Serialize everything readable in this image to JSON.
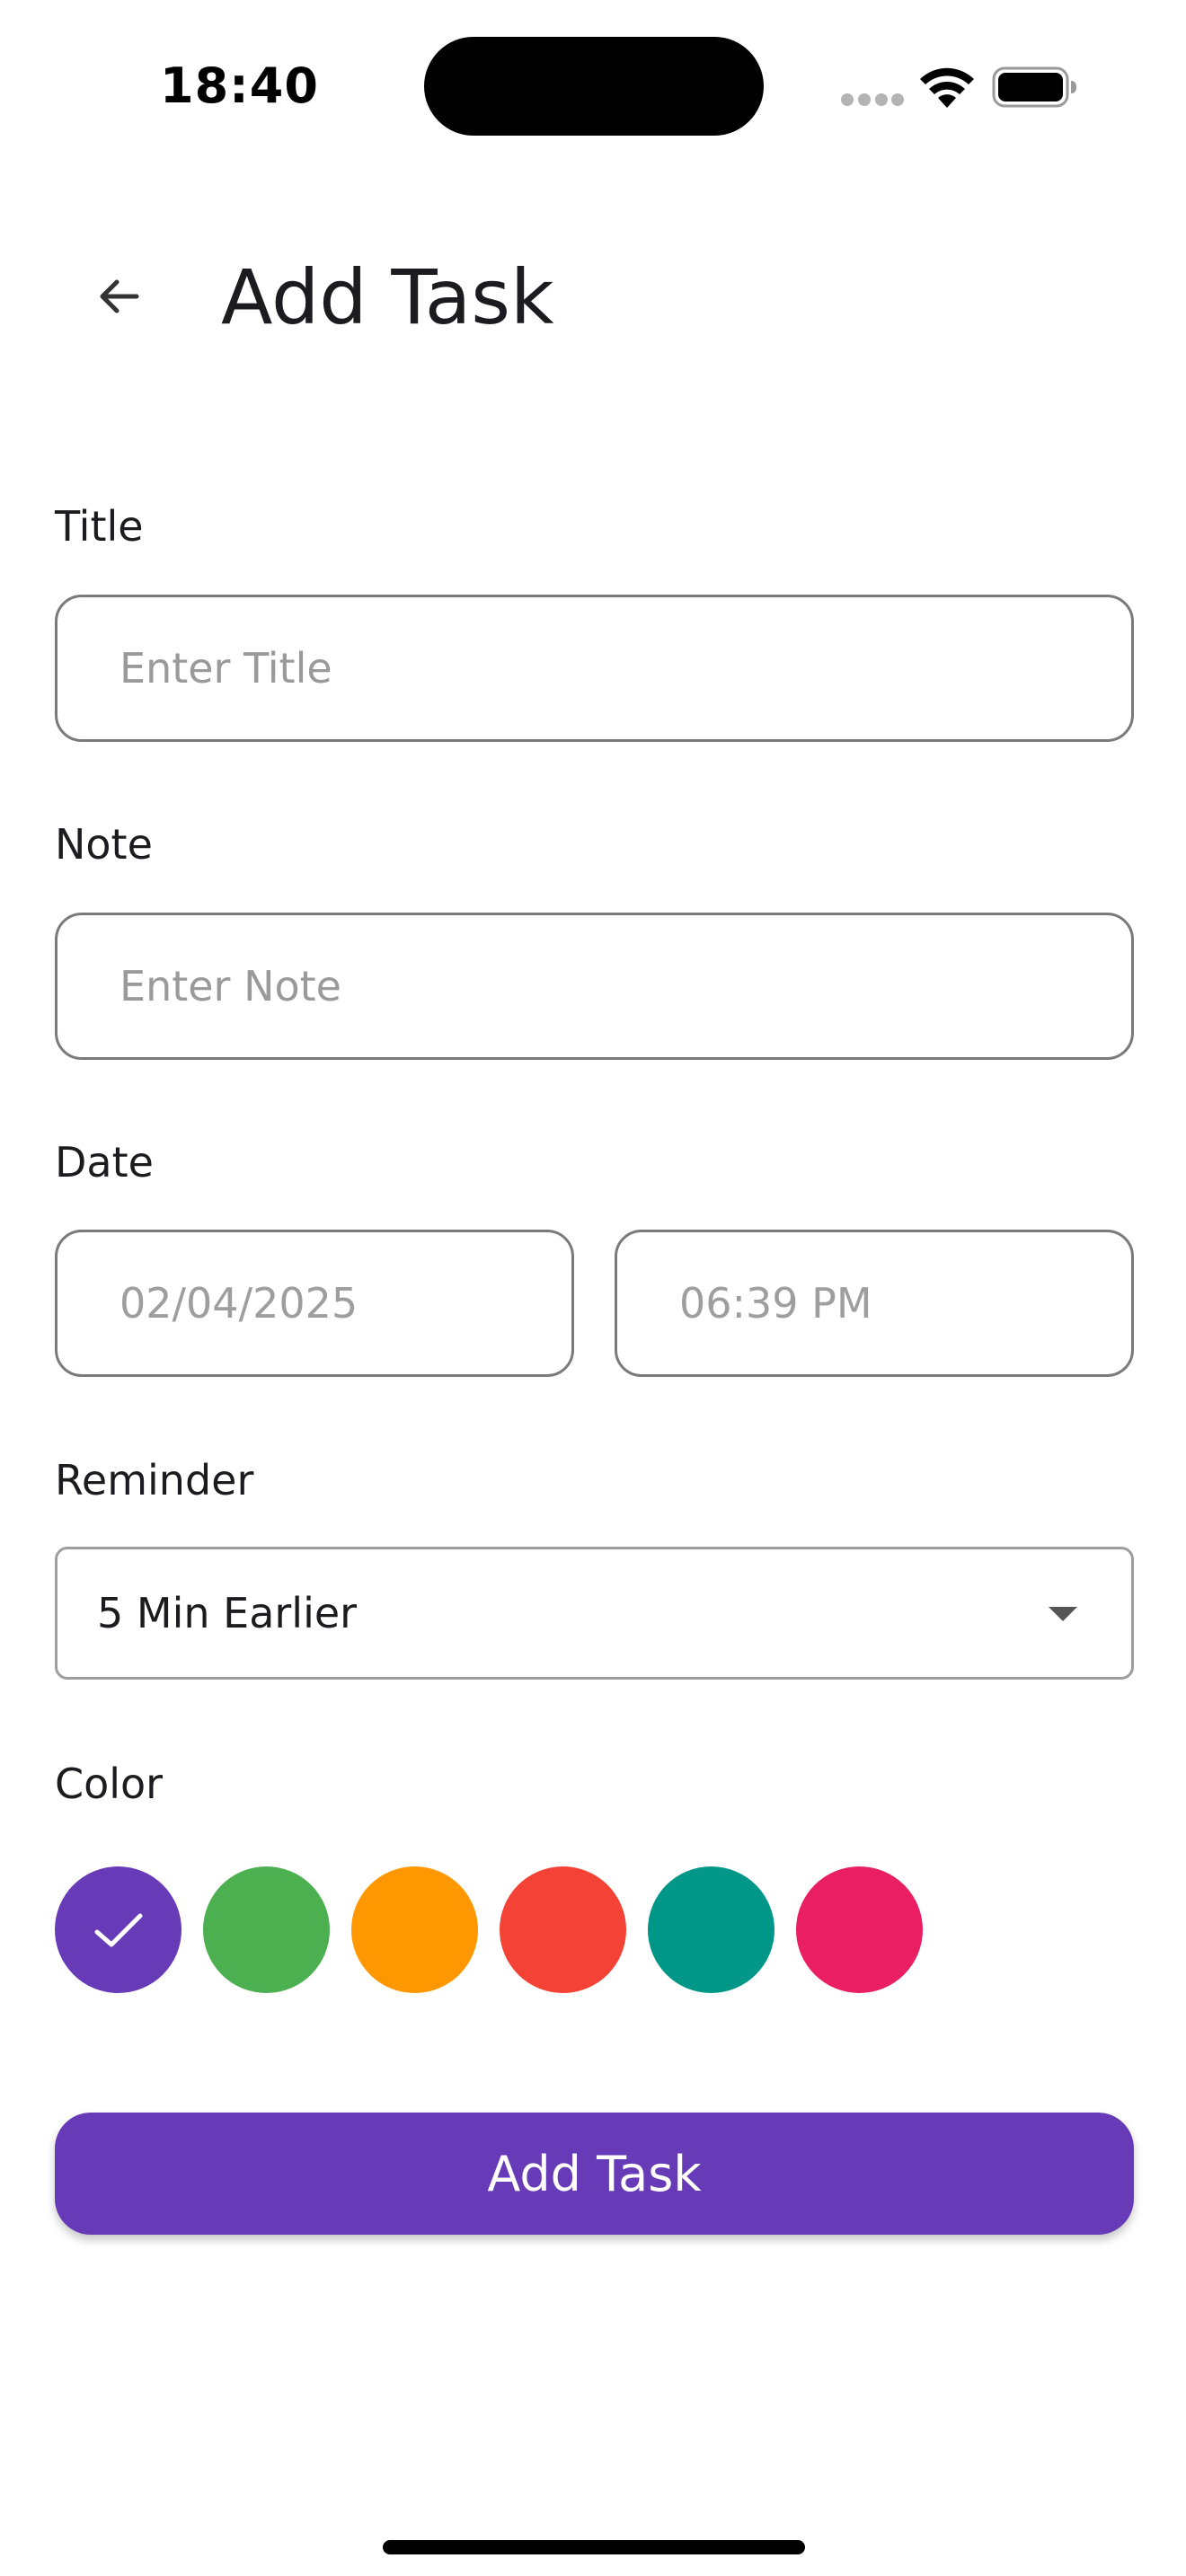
{
  "status_bar": {
    "time": "18:40",
    "wifi_icon": "wifi-icon",
    "battery_icon": "battery-icon",
    "cellular_icon": "cellular-dots-icon"
  },
  "app_bar": {
    "back_icon": "arrow-left-icon",
    "title": "Add Task"
  },
  "form": {
    "title": {
      "label": "Title",
      "value": "",
      "placeholder": "Enter Title"
    },
    "note": {
      "label": "Note",
      "value": "",
      "placeholder": "Enter Note"
    },
    "date": {
      "label": "Date",
      "date_value": "02/04/2025",
      "time_value": "06:39 PM"
    },
    "reminder": {
      "label": "Reminder",
      "selected": "5 Min Earlier",
      "dropdown_icon": "caret-down-icon"
    },
    "color": {
      "label": "Color",
      "selected_index": 0,
      "check_icon": "check-icon",
      "swatches": [
        "#673ab7",
        "#4caf50",
        "#ff9800",
        "#f44336",
        "#009688",
        "#e91e63"
      ]
    }
  },
  "actions": {
    "submit_label": "Add Task",
    "submit_color": "#673ab7"
  }
}
